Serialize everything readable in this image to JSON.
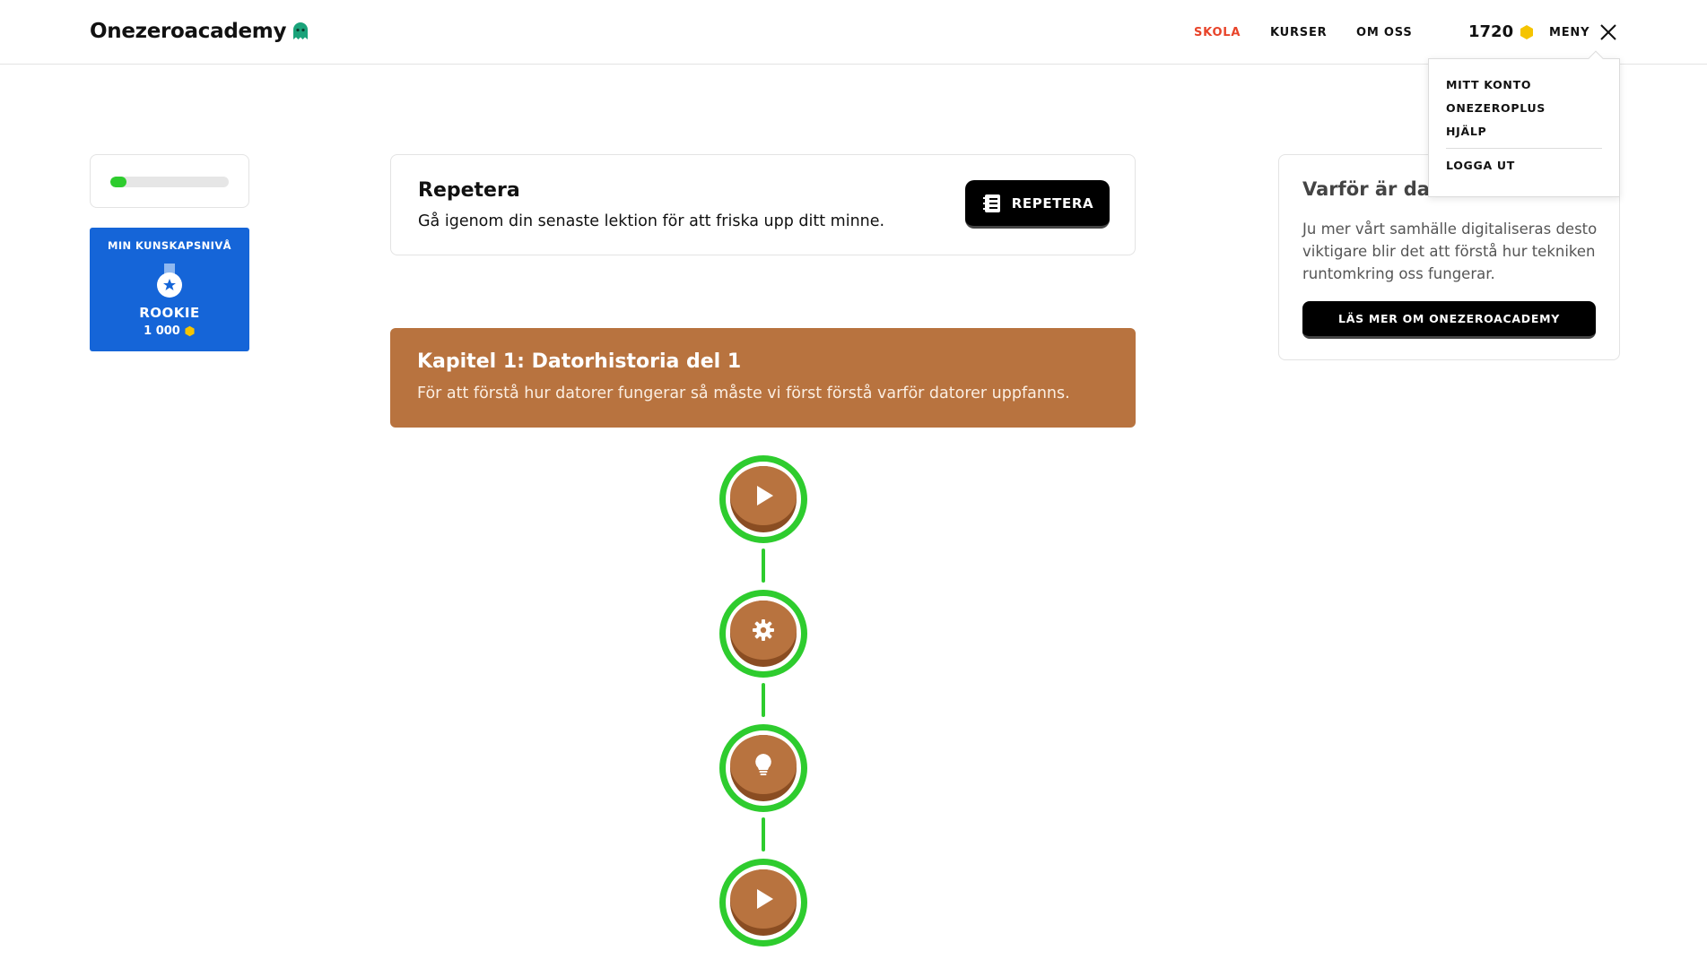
{
  "header": {
    "logo_text": "Onezeroacademy",
    "nav": [
      {
        "label": "SKOLA",
        "active": true
      },
      {
        "label": "KURSER",
        "active": false
      },
      {
        "label": "OM OSS",
        "active": false
      }
    ],
    "points": "1720",
    "menu_label": "MENY"
  },
  "menu": {
    "items": [
      "MITT KONTO",
      "ONEZEROPLUS",
      "HJÄLP"
    ],
    "logout": "LOGGA UT"
  },
  "progress": {
    "fraction": 0.14
  },
  "level": {
    "title": "MIN KUNSKAPSNIVÅ",
    "name": "ROOKIE",
    "points": "1 000"
  },
  "repeat": {
    "title": "Repetera",
    "description": "Gå igenom din senaste lektion för att friska upp ditt minne.",
    "button": "REPETERA"
  },
  "chapter": {
    "title": "Kapitel 1: Datorhistoria del 1",
    "description": "För att förstå hur datorer fungerar så måste vi först förstå varför datorer uppfanns."
  },
  "lessons": [
    {
      "icon": "play-icon",
      "completed": true
    },
    {
      "icon": "gear-icon",
      "completed": true
    },
    {
      "icon": "lightbulb-icon",
      "completed": true
    },
    {
      "icon": "play-icon",
      "completed": true
    }
  ],
  "info": {
    "title": "Varför är dato",
    "description": "Ju mer vårt samhälle digitaliseras desto viktigare blir det att förstå hur tekniken runtomkring oss fungerar.",
    "button": "LÄS MER OM ONEZEROACADEMY"
  },
  "colors": {
    "accent_red": "#e8442a",
    "success_green": "#2ecc2e",
    "level_blue": "#1565d8",
    "chapter_brown": "#b8733f",
    "coin_yellow": "#f5c400"
  }
}
